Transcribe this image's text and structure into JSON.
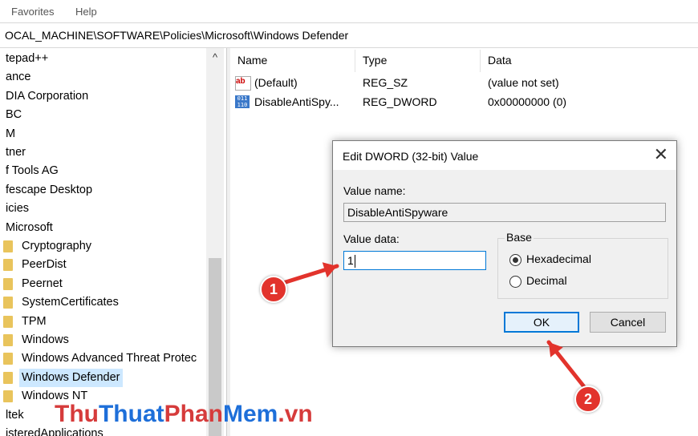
{
  "menu": {
    "items": [
      "Favorites",
      "Help"
    ]
  },
  "address": {
    "path": "OCAL_MACHINE\\SOFTWARE\\Policies\\Microsoft\\Windows Defender"
  },
  "tree": {
    "items": [
      {
        "label": "tepad++",
        "folder": false
      },
      {
        "label": "ance",
        "folder": false
      },
      {
        "label": "DIA Corporation",
        "folder": false
      },
      {
        "label": "BC",
        "folder": false
      },
      {
        "label": "M",
        "folder": false
      },
      {
        "label": "tner",
        "folder": false
      },
      {
        "label": "f Tools AG",
        "folder": false
      },
      {
        "label": "fescape Desktop",
        "folder": false
      },
      {
        "label": "icies",
        "folder": false
      },
      {
        "label": "Microsoft",
        "folder": false
      },
      {
        "label": "Cryptography",
        "folder": true
      },
      {
        "label": "PeerDist",
        "folder": true
      },
      {
        "label": "Peernet",
        "folder": true
      },
      {
        "label": "SystemCertificates",
        "folder": true
      },
      {
        "label": "TPM",
        "folder": true
      },
      {
        "label": "Windows",
        "folder": true
      },
      {
        "label": "Windows Advanced Threat Protec",
        "folder": true
      },
      {
        "label": "Windows Defender",
        "folder": true,
        "selected": true
      },
      {
        "label": "Windows NT",
        "folder": true
      },
      {
        "label": "ltek",
        "folder": false
      },
      {
        "label": "isteredApplications",
        "folder": false
      }
    ]
  },
  "list": {
    "columns": [
      "Name",
      "Type",
      "Data"
    ],
    "rows": [
      {
        "name": "(Default)",
        "type": "REG_SZ",
        "data": "(value not set)",
        "icon": "string-value-icon"
      },
      {
        "name": "DisableAntiSpy...",
        "type": "REG_DWORD",
        "data": "0x00000000 (0)",
        "icon": "binary-value-icon"
      }
    ]
  },
  "dialog": {
    "title": "Edit DWORD (32-bit) Value",
    "close_glyph": "✕",
    "value_name_label": "Value name:",
    "value_name": "DisableAntiSpyware",
    "value_data_label": "Value data:",
    "value_data": "1",
    "base_label": "Base",
    "radio_hex": "Hexadecimal",
    "radio_dec": "Decimal",
    "ok_label": "OK",
    "cancel_label": "Cancel"
  },
  "annotations": {
    "step1": "1",
    "step2": "2",
    "arrow_color": "#e2332c"
  },
  "watermark": {
    "part1": "Thu",
    "part2": "Thuat",
    "part3": "Phan",
    "part4": "Mem",
    "part5": ".vn"
  }
}
